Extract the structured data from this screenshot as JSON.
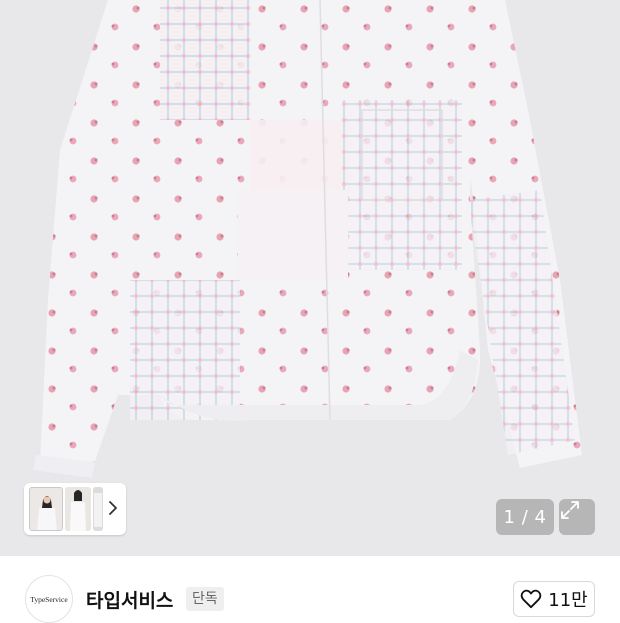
{
  "gallery": {
    "counter": "1 / 4",
    "thumb_icons": [
      "model-front-thumb",
      "model-side-thumb",
      "garment-thumb"
    ],
    "next_icon": "chevron-right-icon",
    "expand_icon": "expand-icon"
  },
  "brand": {
    "logo_text": "TypeService",
    "name": "타입서비스",
    "badge": "단독"
  },
  "like": {
    "icon": "heart-outline-icon",
    "count": "11만"
  },
  "colors": {
    "backdrop": "#e8e8ea",
    "garment": "#f3f2f5",
    "flower_pink": "#e8a9b8",
    "grid_blue": "#9fc9e6"
  }
}
